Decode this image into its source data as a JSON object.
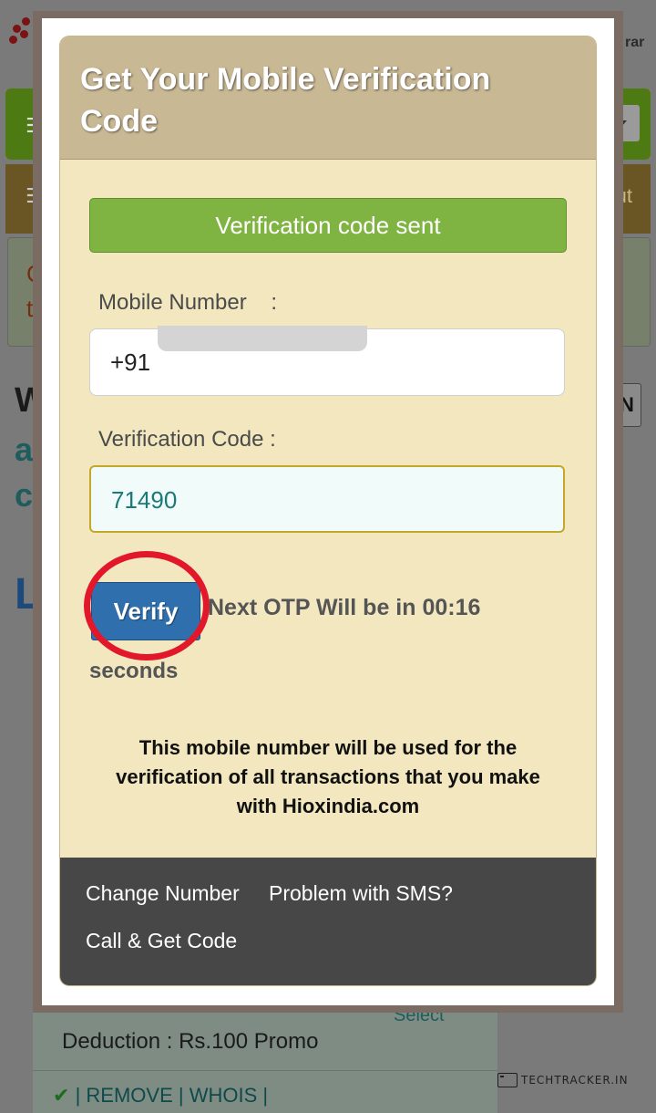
{
  "background": {
    "registrar_fragment": "rar",
    "menu_glyph": "☰",
    "out_fragment": "ut",
    "notice_line1_fragment": "C",
    "notice_line2_fragment": "t",
    "heading_fragment_w": "W",
    "text_fragment_a": "a",
    "text_fragment_c": "c",
    "heading_fragment_l": "L",
    "button_fragment_n": "N",
    "select_link": "Select",
    "deduction": "Deduction : Rs.100 Promo",
    "actions": {
      "check": "✔",
      "divider": "|",
      "remove": "REMOVE",
      "whois": "WHOIS"
    },
    "watermark": "TECHTRACKER.IN"
  },
  "modal": {
    "title": "Get Your Mobile Verification Code",
    "status_banner": "Verification code sent",
    "mobile_label": "Mobile Number    :",
    "mobile_value": "+91",
    "code_label": "Verification Code :",
    "code_value": "71490",
    "verify_button": "Verify",
    "otp_timer_text": "Next OTP Will be in 00:16",
    "otp_timer_unit": "seconds",
    "notice": "This mobile number will be used for the verification of all transactions that you make with Hioxindia.com",
    "footer_links": {
      "change_number": "Change Number",
      "problem_sms": "Problem with SMS?",
      "call_get_code": "Call & Get Code"
    }
  },
  "colors": {
    "header_bg": "#c9b894",
    "body_bg": "#f2e7bf",
    "status_green": "#7fb342",
    "verify_blue": "#2f6fae",
    "annotation_red": "#e3172a",
    "footer_bg": "#474747"
  }
}
